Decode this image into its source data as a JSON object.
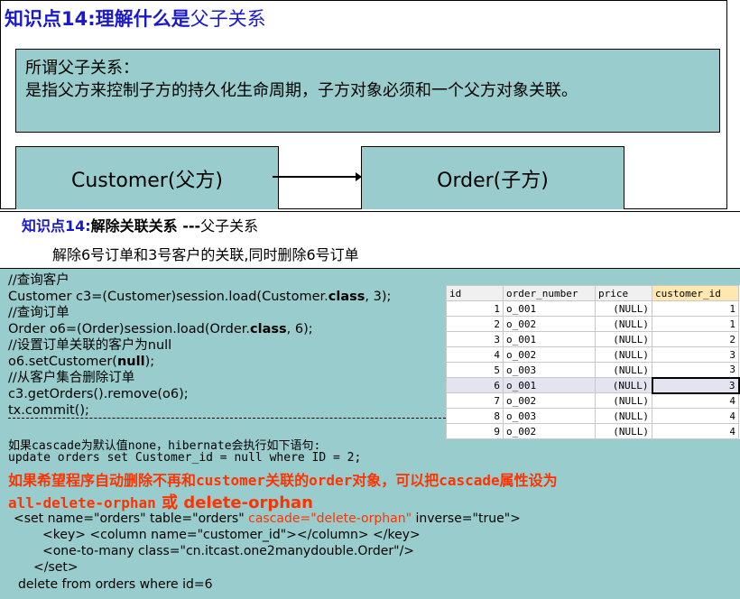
{
  "slide1": {
    "title_bold": "知识点14:理解什么是",
    "title_normal": "父子关系",
    "definition_label": "所谓父子关系：",
    "definition_text": "是指父方来控制子方的持久化生命周期，子方对象必须和一个父方对象关联。",
    "parent_node": "Customer(父方)",
    "child_node": "Order(子方)"
  },
  "slide2": {
    "title_blue": "知识点14:",
    "title_bold": "解除关联关系 ---",
    "title_normal": "父子关系",
    "subtitle": "解除6号订单和3号客户的关联,同时删除6号订单",
    "code": [
      {
        "text": "//查询客户"
      },
      {
        "pre": "Customer c3=(Customer)session.load(Customer.",
        "kw": "class",
        "post": ", 3);"
      },
      {
        "text": "//查询订单"
      },
      {
        "pre": "Order o6=(Order)session.load(Order.",
        "kw": "class",
        "post": ",  6);"
      },
      {
        "text": "//设置订单关联的客户为null"
      },
      {
        "pre": "o6.setCustomer(",
        "kw": "null",
        "post": ");"
      },
      {
        "text": "//从客户集合删除订单"
      },
      {
        "text": "c3.getOrders().remove(o6);"
      },
      {
        "text": "tx.commit();"
      }
    ],
    "note1": "如果cascade为默认值none，hibernate会执行如下语句:",
    "sql1": "update orders set Customer_id = null where ID = 2;",
    "hint_line1": "如果希望程序自动删除不再和customer关联的order对象，可以把cascade属性设为",
    "hint_opt1": "all-delete-orphan",
    "hint_or": "或",
    "hint_opt2": "delete-orphan",
    "xml": {
      "set_pre": "<set name=\"orders\" table=\"orders\"",
      "set_cascade": "cascade=\"delete-orphan\"",
      "set_post": "inverse=\"true\">",
      "key": "<key> <column name=\"customer_id\"></column>   </key>",
      "one_to_many": "<one-to-many class=\"cn.itcast.one2manydouble.Order\"/>",
      "close": "</set>"
    },
    "sql2": "delete from orders where id=6",
    "table": {
      "columns": [
        "id",
        "order_number",
        "price",
        "customer_id"
      ],
      "rows": [
        [
          "1",
          "o_001",
          "(NULL)",
          "1"
        ],
        [
          "2",
          "o_002",
          "(NULL)",
          "1"
        ],
        [
          "3",
          "o_001",
          "(NULL)",
          "2"
        ],
        [
          "4",
          "o_002",
          "(NULL)",
          "3"
        ],
        [
          "5",
          "o_003",
          "(NULL)",
          "3"
        ],
        [
          "6",
          "o_001",
          "(NULL)",
          "3"
        ],
        [
          "7",
          "o_002",
          "(NULL)",
          "4"
        ],
        [
          "8",
          "o_003",
          "(NULL)",
          "4"
        ],
        [
          "9",
          "o_002",
          "(NULL)",
          "4"
        ]
      ],
      "selected_row": 5
    }
  }
}
